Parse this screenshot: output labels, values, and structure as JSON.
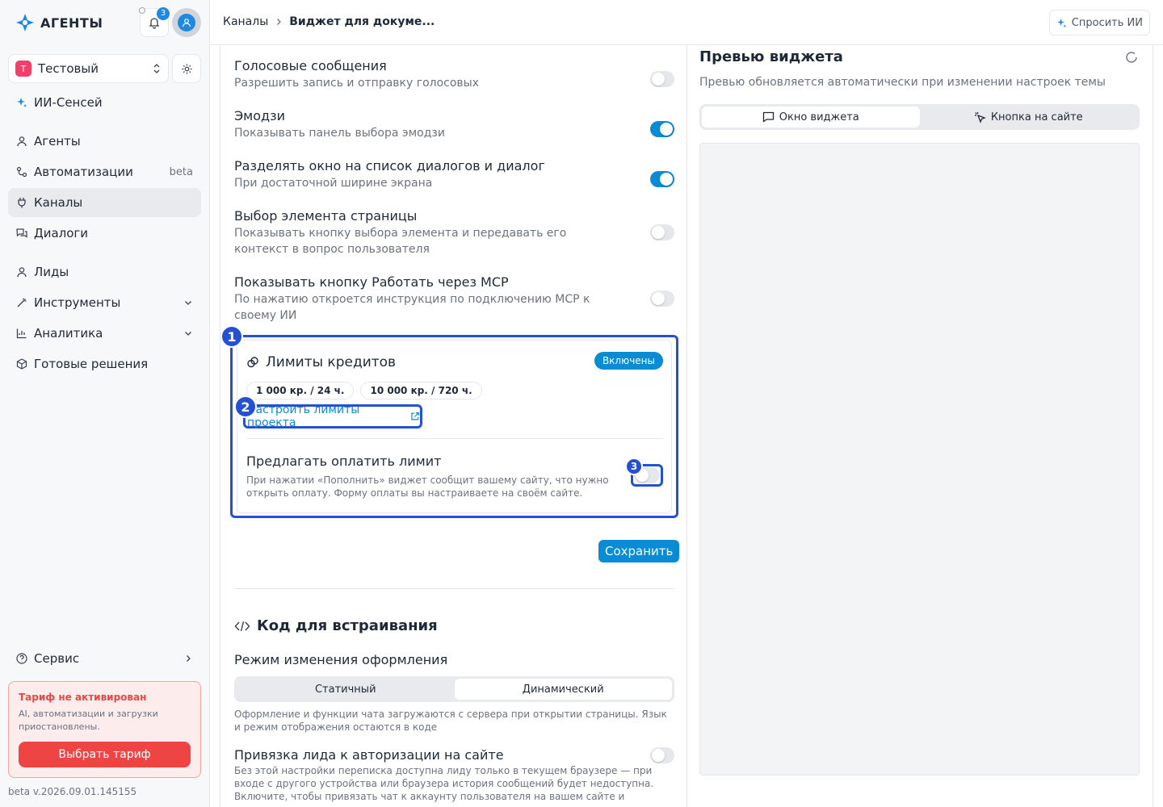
{
  "app": {
    "logo_text": "АГЕНТЫ",
    "notifications_count": "3"
  },
  "project": {
    "letter": "Т",
    "name": "Тестовый"
  },
  "sidebar": {
    "items": [
      {
        "label": "ИИ-Сенсей",
        "icon": "sparkle-icon"
      },
      {
        "label": "Агенты",
        "icon": "user-icon"
      },
      {
        "label": "Автоматизации",
        "icon": "workflow-icon",
        "meta": "beta"
      },
      {
        "label": "Каналы",
        "icon": "plug-icon",
        "active": true
      },
      {
        "label": "Диалоги",
        "icon": "chat-icon"
      },
      {
        "label": "Лиды",
        "icon": "user-icon"
      },
      {
        "label": "Инструменты",
        "icon": "wand-icon"
      },
      {
        "label": "Аналитика",
        "icon": "chart-icon"
      },
      {
        "label": "Готовые решения",
        "icon": "box-icon"
      }
    ],
    "service": "Сервис",
    "tariff": {
      "title": "Тариф не активирован",
      "text": "AI, автоматизации и загрузки приостановлены.",
      "button": "Выбрать тариф"
    },
    "version": "beta v.2026.09.01.145155"
  },
  "topbar": {
    "breadcrumb": [
      "Каналы",
      "Виджет для докуме..."
    ],
    "ask_ai": "Спросить ИИ"
  },
  "settings": [
    {
      "title": "Голосовые сообщения",
      "desc": "Разрешить запись и отправку голосовых",
      "enabled": false
    },
    {
      "title": "Эмодзи",
      "desc": "Показывать панель выбора эмодзи",
      "enabled": true
    },
    {
      "title": "Разделять окно на список диалогов и диалог",
      "desc": "При достаточной ширине экрана",
      "enabled": true
    },
    {
      "title": "Выбор элемента страницы",
      "desc": "Показывать кнопку выбора элемента и передавать его контекст в вопрос пользователя",
      "enabled": false
    },
    {
      "title": "Показывать кнопку Работать через MCP",
      "desc": "По нажатию откроется инструкция по подключению MCP к своему ИИ",
      "enabled": false
    }
  ],
  "limits": {
    "title": "Лимиты кредитов",
    "status": "Включены",
    "chips": [
      "1 000 кр. / 24 ч.",
      "10 000 кр. / 720 ч."
    ],
    "link": "Настроить лимиты проекта",
    "pay_title": "Предлагать оплатить лимит",
    "pay_desc": "При нажатии «Пополнить» виджет сообщит вашему сайту, что нужно открыть оплату. Форму оплаты вы настраиваете на своём сайте.",
    "pay_enabled": false,
    "steps": [
      "1",
      "2",
      "3"
    ]
  },
  "save_label": "Сохранить",
  "embed": {
    "title": "Код для встраивания",
    "mode_label": "Режим изменения оформления",
    "modes": [
      "Статичный",
      "Динамический"
    ],
    "active_mode": "Динамический",
    "mode_desc": "Оформление и функции чата загружаются с сервера при открытии страницы. Язык и режим отображения остаются в коде",
    "lead_title": "Привязка лида к авторизации на сайте",
    "lead_desc": "Без этой настройки переписка доступна лиду только в текущем браузере — при входе с другого устройства или браузера история сообщений будет недоступна. Включите, чтобы привязать чат к аккаунту пользователя на вашем сайте и сохранить доступ к",
    "lead_enabled": false
  },
  "preview": {
    "title": "Превью виджета",
    "subtitle": "Превью обновляется автоматически при изменении настроек темы",
    "tabs": [
      "Окно виджета",
      "Кнопка на сайте"
    ],
    "active_tab": "Окно виджета"
  },
  "colors": {
    "accent": "#0a8bd6",
    "highlight": "#2450d4",
    "danger": "#ef4444"
  }
}
